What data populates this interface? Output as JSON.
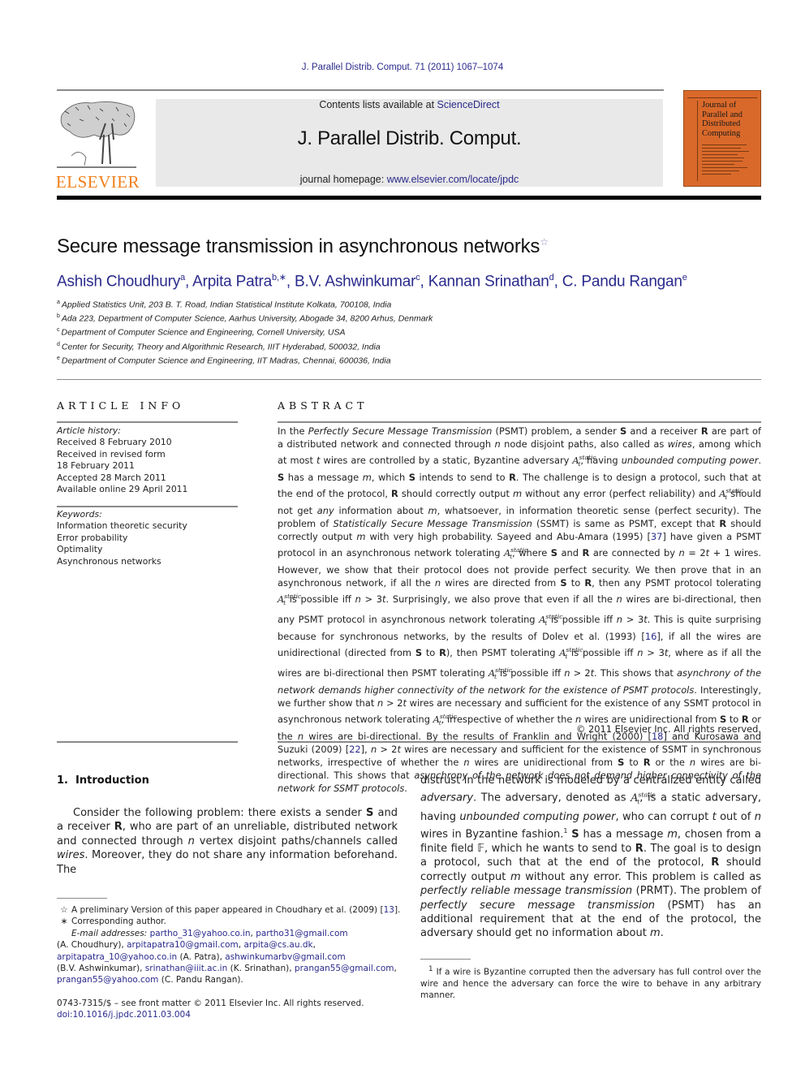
{
  "header": {
    "running_head": "J. Parallel Distrib. Comput. 71 (2011) 1067–1074",
    "contents_prefix": "Contents lists available at ",
    "contents_link": "ScienceDirect",
    "journal_title": "J. Parallel Distrib. Comput.",
    "homepage_prefix": "journal homepage: ",
    "homepage_link": "www.elsevier.com/locate/jpdc",
    "publisher_logo_text": "ELSEVIER",
    "cover_title_lines": [
      "Journal of",
      "Parallel and",
      "Distributed",
      "Computing"
    ]
  },
  "article": {
    "title": "Secure message transmission in asynchronous networks",
    "title_mark": "☆",
    "authors": [
      {
        "name": "Ashish Choudhury",
        "sup": "a"
      },
      {
        "name": "Arpita Patra",
        "sup": "b,∗"
      },
      {
        "name": "B.V. Ashwinkumar",
        "sup": "c"
      },
      {
        "name": "Kannan Srinathan",
        "sup": "d"
      },
      {
        "name": "C. Pandu Rangan",
        "sup": "e"
      }
    ],
    "affiliations": [
      {
        "sup": "a",
        "text": "Applied Statistics Unit, 203 B. T. Road, Indian Statistical Institute Kolkata, 700108, India"
      },
      {
        "sup": "b",
        "text": "Ada 223, Department of Computer Science, Aarhus University, Abogade 34, 8200 Arhus, Denmark"
      },
      {
        "sup": "c",
        "text": "Department of Computer Science and Engineering, Cornell University, USA"
      },
      {
        "sup": "d",
        "text": "Center for Security, Theory and Algorithmic Research, IIIT Hyderabad, 500032, India"
      },
      {
        "sup": "e",
        "text": "Department of Computer Science and Engineering, IIT Madras, Chennai, 600036, India"
      }
    ]
  },
  "article_info": {
    "heading": "ARTICLE INFO",
    "history_label": "Article history:",
    "history": [
      "Received 8 February 2010",
      "Received in revised form",
      "18 February 2011",
      "Accepted 28 March 2011",
      "Available online 29 April 2011"
    ],
    "keywords_label": "Keywords:",
    "keywords": [
      "Information theoretic security",
      "Error probability",
      "Optimality",
      "Asynchronous networks"
    ]
  },
  "abstract": {
    "heading": "ABSTRACT",
    "adv_sym": "A",
    "adv_sup": "static",
    "adv_sub": "t",
    "refs": {
      "r37": "37",
      "r16": "16",
      "r18": "18",
      "r22": "22"
    },
    "copyright": "© 2011 Elsevier Inc. All rights reserved."
  },
  "introduction": {
    "heading_num": "1.",
    "heading": "Introduction",
    "footnote_ref": "1"
  },
  "footnotes": {
    "star_mark": "☆",
    "star_text": "A preliminary Version of this paper appeared in Choudhary et al. (2009) [",
    "star_ref": "13",
    "corr_mark": "∗",
    "corr_text": "Corresponding author.",
    "email_label": "E-mail addresses:",
    "emails": [
      "partho_31@yahoo.co.in",
      "partho31@gmail.com",
      "arpitapatra10@gmail.com",
      "arpita@cs.au.dk",
      "arpitapatra_10@yahoo.co.in",
      "ashwinkumarbv@gmail.com",
      "srinathan@iiit.ac.in",
      "prangan55@gmail.com",
      "prangan55@yahoo.com"
    ],
    "email_owners": [
      "(A. Choudhury),",
      "(A. Patra),",
      "(B.V. Ashwinkumar),",
      "(K. Srinathan),",
      "(C. Pandu Rangan)."
    ],
    "fn1_mark": "1",
    "fn1_text": "If a wire is Byzantine corrupted then the adversary has full control over the wire and hence the adversary can force the wire to behave in any arbitrary manner."
  },
  "front_matter": {
    "issn_line": "0743-7315/$ – see front matter © 2011 Elsevier Inc. All rights reserved.",
    "doi": "doi:10.1016/j.jpdc.2011.03.004"
  }
}
